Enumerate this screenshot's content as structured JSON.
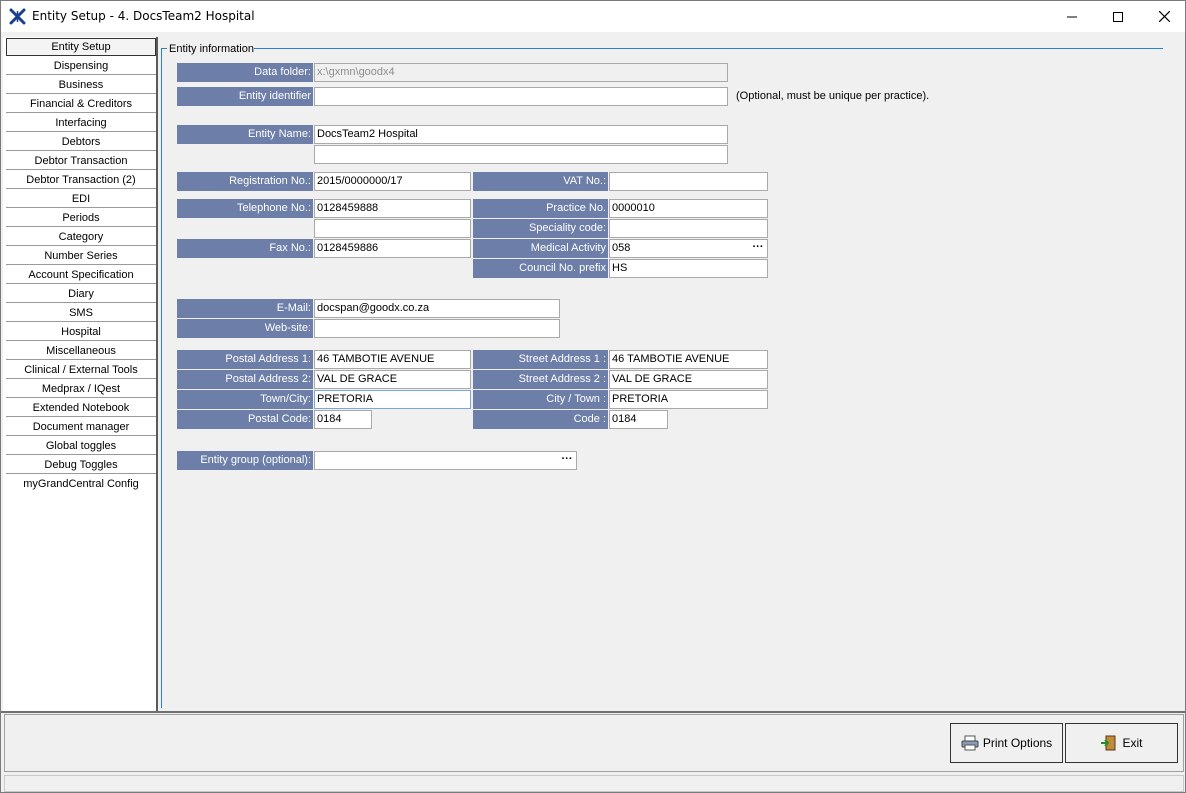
{
  "window": {
    "title": "Entity Setup - 4. DocsTeam2 Hospital"
  },
  "sidebar": {
    "items": [
      {
        "label": "Entity Setup",
        "active": true
      },
      {
        "label": "Dispensing"
      },
      {
        "label": "Business"
      },
      {
        "label": "Financial & Creditors"
      },
      {
        "label": "Interfacing"
      },
      {
        "label": "Debtors"
      },
      {
        "label": "Debtor Transaction"
      },
      {
        "label": "Debtor Transaction (2)"
      },
      {
        "label": "EDI"
      },
      {
        "label": "Periods"
      },
      {
        "label": "Category"
      },
      {
        "label": "Number Series"
      },
      {
        "label": "Account Specification"
      },
      {
        "label": "Diary"
      },
      {
        "label": "SMS"
      },
      {
        "label": "Hospital"
      },
      {
        "label": "Miscellaneous"
      },
      {
        "label": "Clinical / External Tools"
      },
      {
        "label": "Medprax / IQest"
      },
      {
        "label": "Extended Notebook"
      },
      {
        "label": "Document manager"
      },
      {
        "label": "Global toggles"
      },
      {
        "label": "Debug Toggles"
      },
      {
        "label": "myGrandCentral Config"
      }
    ]
  },
  "entity_info": {
    "group_title": "Entity information",
    "data_folder": {
      "label": "Data folder:",
      "value": "x:\\gxmn\\goodx4"
    },
    "entity_identifier": {
      "label": "Entity identifier",
      "value": "",
      "note": "(Optional, must be unique per practice)."
    },
    "entity_name": {
      "label": "Entity Name:",
      "value": "DocsTeam2 Hospital",
      "value2": ""
    },
    "registration_no": {
      "label": "Registration No.:",
      "value": "2015/0000000/17"
    },
    "vat_no": {
      "label": "VAT No.:",
      "value": ""
    },
    "telephone_no": {
      "label": "Telephone No.:",
      "value": "0128459888",
      "value2": ""
    },
    "practice_no": {
      "label": "Practice No.",
      "value": "0000010"
    },
    "speciality_code": {
      "label": "Speciality code:",
      "value": ""
    },
    "fax_no": {
      "label": "Fax No.:",
      "value": "0128459886"
    },
    "medical_activity": {
      "label": "Medical Activity",
      "value": "058"
    },
    "council_no_prefix": {
      "label": "Council No. prefix",
      "value": "HS"
    },
    "email": {
      "label": "E-Mail:",
      "value": "docspan@goodx.co.za"
    },
    "website": {
      "label": "Web-site:",
      "value": ""
    },
    "postal_address_1": {
      "label": "Postal Address 1:",
      "value": "46 TAMBOTIE AVENUE"
    },
    "postal_address_2": {
      "label": "Postal Address 2:",
      "value": "VAL DE GRACE"
    },
    "town_city": {
      "label": "Town/City:",
      "value": "PRETORIA"
    },
    "postal_code": {
      "label": "Postal Code:",
      "value": "0184"
    },
    "street_address_1": {
      "label": "Street Address 1 :",
      "value": "46 TAMBOTIE AVENUE"
    },
    "street_address_2": {
      "label": "Street Address 2 :",
      "value": "VAL DE GRACE"
    },
    "city_town": {
      "label": "City / Town :",
      "value": "PRETORIA"
    },
    "code": {
      "label": "Code :",
      "value": "0184"
    },
    "entity_group": {
      "label": "Entity group (optional):",
      "value": ""
    },
    "ellipsis": "···"
  },
  "footer": {
    "print_options_label": "Print Options",
    "exit_label": "Exit"
  },
  "colors": {
    "label_bg": "#6d7fa8",
    "group_line": "#2b80d6"
  }
}
